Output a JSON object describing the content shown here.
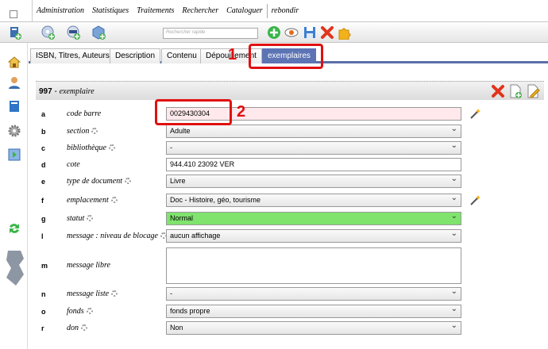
{
  "menu": {
    "items": [
      "Administration",
      "Statistiques",
      "Traitements",
      "Rechercher",
      "Cataloguer",
      "rebondir"
    ]
  },
  "toolbar": {
    "search_placeholder": "Rechercher rapide"
  },
  "tabs": [
    "ISBN, Titres, Auteurs",
    "Description",
    "Contenu",
    "Dépouillement",
    "exemplaires"
  ],
  "panel": {
    "code": "997",
    "dash": " - ",
    "title": "exemplaire"
  },
  "fields": [
    {
      "code": "a",
      "label": "code barre",
      "value": "0029430304"
    },
    {
      "code": "b",
      "label": "section",
      "value": "Adulte"
    },
    {
      "code": "c",
      "label": "bibliothèque",
      "value": "-"
    },
    {
      "code": "d",
      "label": "cote",
      "value": "944.410 23092 VER"
    },
    {
      "code": "e",
      "label": "type de document",
      "value": "Livre"
    },
    {
      "code": "f",
      "label": "emplacement",
      "value": "Doc - Histoire, géo, tourisme"
    },
    {
      "code": "g",
      "label": "statut",
      "value": "Normal"
    },
    {
      "code": "l",
      "label": "message : niveau de blocage",
      "value": "aucun affichage"
    },
    {
      "code": "m",
      "label": "message libre",
      "value": ""
    },
    {
      "code": "n",
      "label": "message liste",
      "value": "-"
    },
    {
      "code": "o",
      "label": "fonds",
      "value": "fonds propre"
    },
    {
      "code": "r",
      "label": "don",
      "value": "Non"
    }
  ],
  "annotations": [
    "1",
    "2"
  ],
  "colors": {
    "tab_active": "#5c73b4",
    "status_green": "#7fe36e",
    "annotation_red": "#e01010"
  }
}
